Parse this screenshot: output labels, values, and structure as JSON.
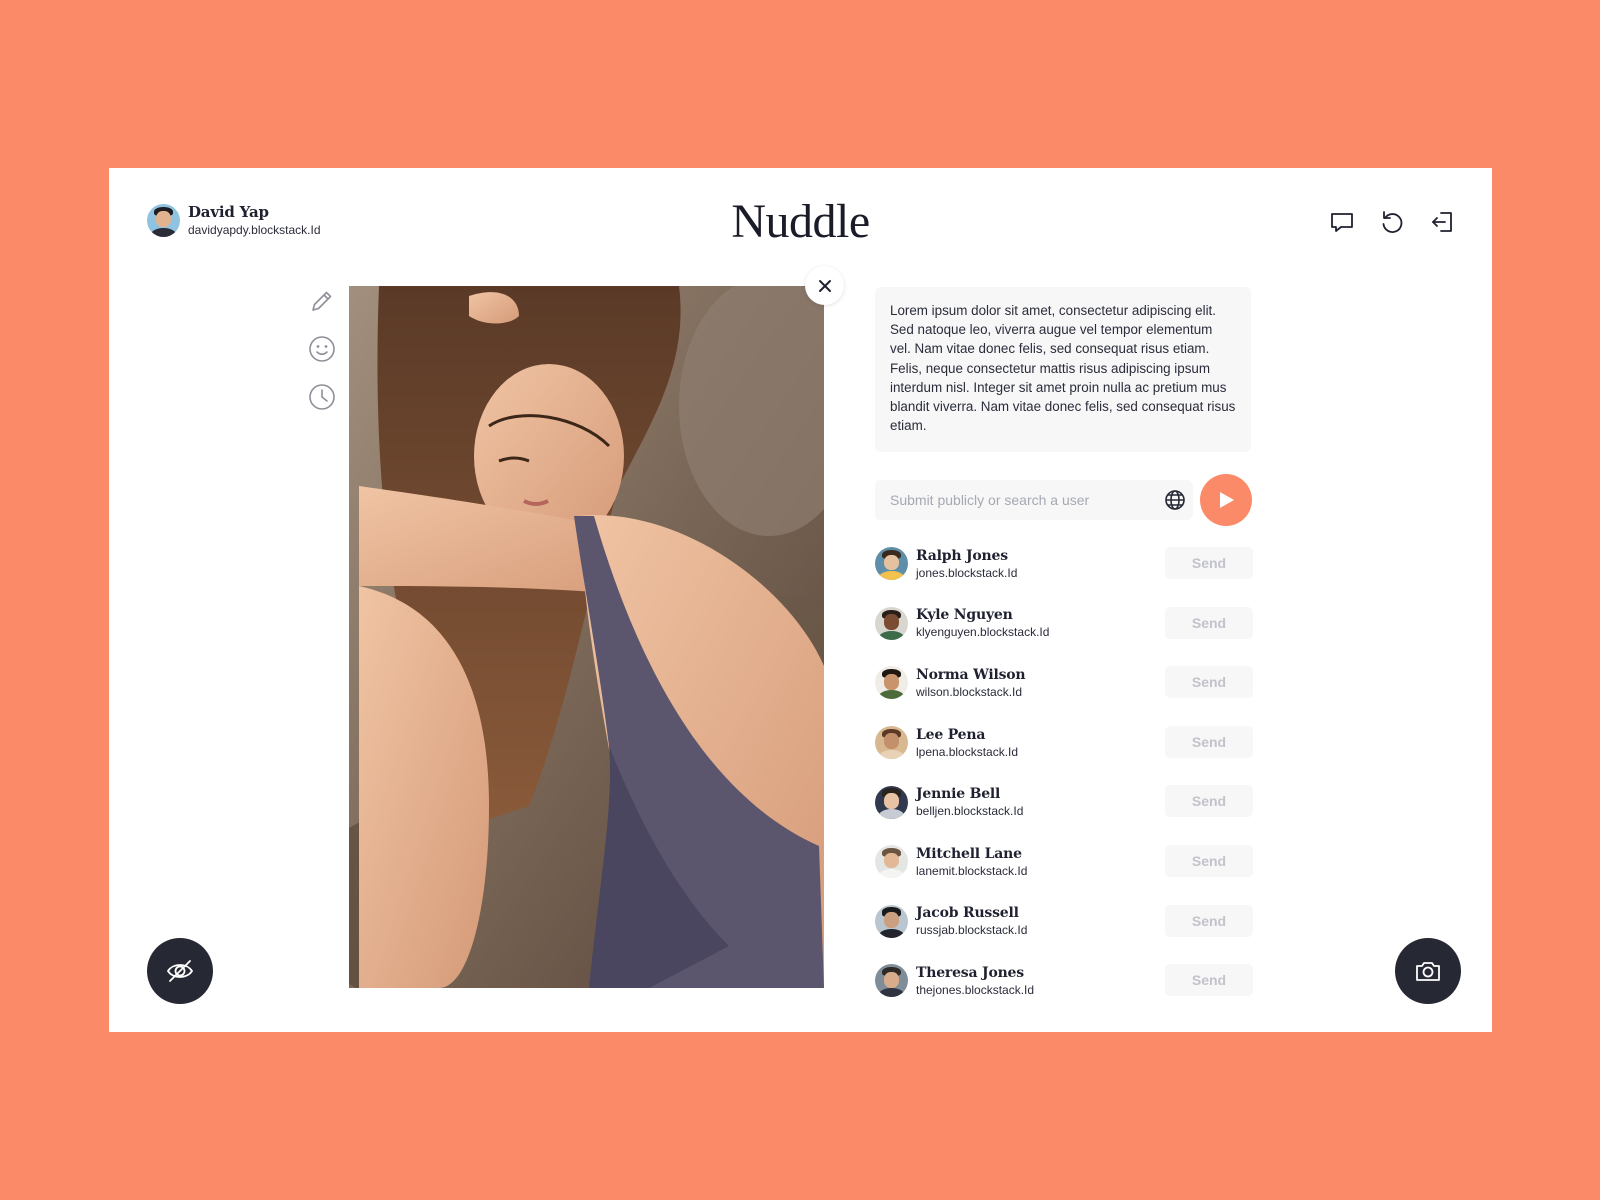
{
  "app": {
    "title": "Nuddle",
    "accent_color": "#FB8A69",
    "dark_button_color": "#262833"
  },
  "profile": {
    "name": "David Yap",
    "handle": "davidyapdy.blockstack.Id",
    "avatar_colors": {
      "bg": "#8fc3e0",
      "face": "#e2b38f",
      "hair": "#1d1d22",
      "body": "#2b2d36"
    }
  },
  "header_icons": [
    "chat-bubble-icon",
    "refresh-icon",
    "logout-icon"
  ],
  "tools": [
    "pencil-icon",
    "smiley-icon",
    "clock-icon"
  ],
  "post": {
    "caption": "Lorem ipsum dolor sit amet, consectetur adipiscing elit. Sed natoque leo, viverra augue vel tempor elementum vel. Nam vitae donec felis, sed consequat risus etiam. Felis, neque consectetur mattis risus adipiscing ipsum interdum nisl. Integer sit amet proin nulla ac pretium mus blandit viverra.  Nam vitae donec felis, sed consequat risus etiam."
  },
  "search": {
    "placeholder": "Submit publicly or search a user"
  },
  "send_label": "Send",
  "users": [
    {
      "name": "Ralph Jones",
      "handle": "jones.blockstack.Id",
      "avatar_colors": {
        "bg": "#5f8fa8",
        "face": "#e6c1a0",
        "hair": "#3a2a1e",
        "body": "#f2c14e"
      }
    },
    {
      "name": "Kyle Nguyen",
      "handle": "klyenguyen.blockstack.Id",
      "avatar_colors": {
        "bg": "#d9d6cf",
        "face": "#7a4d33",
        "hair": "#2a1e18",
        "body": "#3c6b4a"
      }
    },
    {
      "name": "Norma Wilson",
      "handle": "wilson.blockstack.Id",
      "avatar_colors": {
        "bg": "#f0ede6",
        "face": "#c9936c",
        "hair": "#1f1712",
        "body": "#4d6b3a"
      }
    },
    {
      "name": "Lee Pena",
      "handle": "lpena.blockstack.Id",
      "avatar_colors": {
        "bg": "#d8b890",
        "face": "#c4906b",
        "hair": "#5a3a26",
        "body": "#e8d2b6"
      }
    },
    {
      "name": "Jennie Bell",
      "handle": "belljen.blockstack.Id",
      "avatar_colors": {
        "bg": "#30394d",
        "face": "#e8c3a3",
        "hair": "#2a241f",
        "body": "#c7cbd4"
      }
    },
    {
      "name": "Mitchell Lane",
      "handle": "lanemit.blockstack.Id",
      "avatar_colors": {
        "bg": "#e4e6e3",
        "face": "#e2b896",
        "hair": "#6b5440",
        "body": "#f4f4f2"
      }
    },
    {
      "name": "Jacob Russell",
      "handle": "russjab.blockstack.Id",
      "avatar_colors": {
        "bg": "#b9c6cf",
        "face": "#caa080",
        "hair": "#1b1b1e",
        "body": "#22252c"
      }
    },
    {
      "name": "Theresa Jones",
      "handle": "thejones.blockstack.Id",
      "avatar_colors": {
        "bg": "#7f8d99",
        "face": "#d8ab8a",
        "hair": "#2e2a28",
        "body": "#2f3440"
      }
    }
  ],
  "floating_buttons": {
    "left": "eye-off-icon",
    "right": "camera-icon"
  }
}
